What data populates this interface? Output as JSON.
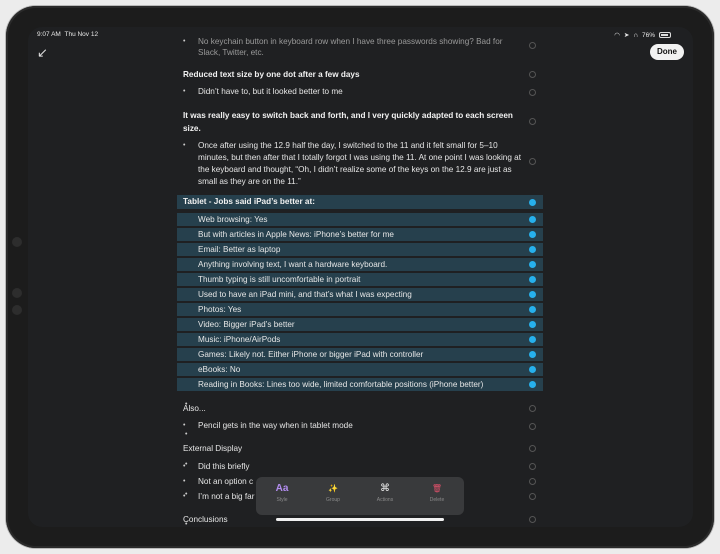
{
  "status": {
    "time": "9:07 AM",
    "date": "Thu Nov 12",
    "battery": "76%",
    "icons": [
      "wifi-icon",
      "location-icon",
      "headphones-icon"
    ]
  },
  "nav": {
    "done_label": "Done",
    "back_icon": "arrow-down-left-icon"
  },
  "content": {
    "top_partial_1": "No keychain button in keyboard row when I have three passwords showing? Bad for",
    "top_partial_2": "Slack, Twitter, etc.",
    "reduced_heading": "Reduced text size by one dot after a few days",
    "reduced_bullet": "Didn’t have to, but it looked better to me",
    "switch_heading_1": "It was really easy to switch back and forth, and I very quickly adapted to each screen",
    "switch_heading_2": "size.",
    "switch_bullet_1": "Once after using the 12.9 half the day, I switched to the 11 and it felt small for 5–10",
    "switch_bullet_2": "minutes, but then after that I totally forgot I was using the 11. At one point I was looking at",
    "switch_bullet_3": "the keyboard and thought, “Oh, I didn’t realize some of the keys on the 12.9 are just as",
    "switch_bullet_4": "small as they are on the 11.”",
    "tablet_heading": "Tablet - Jobs said iPad’s better at:",
    "tablet_items": [
      "Web browsing: Yes",
      "But with articles in Apple News: iPhone’s better for me",
      "Email: Better as laptop",
      "Anything involving text, I want a hardware keyboard.",
      "Thumb typing is still uncomfortable in portrait",
      "Used to have an iPad mini, and that’s what I was expecting",
      "Photos: Yes",
      "Video: Bigger iPad’s better",
      "Music: iPhone/AirPods",
      "Games: Likely not. Either iPhone or bigger iPad with controller",
      "eBooks: No",
      "Reading in Books: Lines too wide, limited comfortable positions (iPhone better)"
    ],
    "also_heading": "Also...",
    "also_bullet": "Pencil gets in the way when in tablet mode",
    "external_heading": "External Display",
    "external_items": [
      "Did this briefly",
      "Not an option c",
      "I’m not a big far"
    ],
    "conclusions_heading": "Conclusions"
  },
  "toolbar": {
    "style_label": "Style",
    "style_icon": "Aa",
    "group_label": "Group",
    "group_icon": "✨",
    "actions_label": "Actions",
    "actions_icon": "⌘",
    "delete_label": "Delete",
    "delete_icon": "🗑"
  },
  "colors": {
    "accent": "#27b0ec",
    "selection": "#26404d",
    "background": "#1f2022",
    "delete": "#e0506a",
    "style": "#b38df0"
  }
}
